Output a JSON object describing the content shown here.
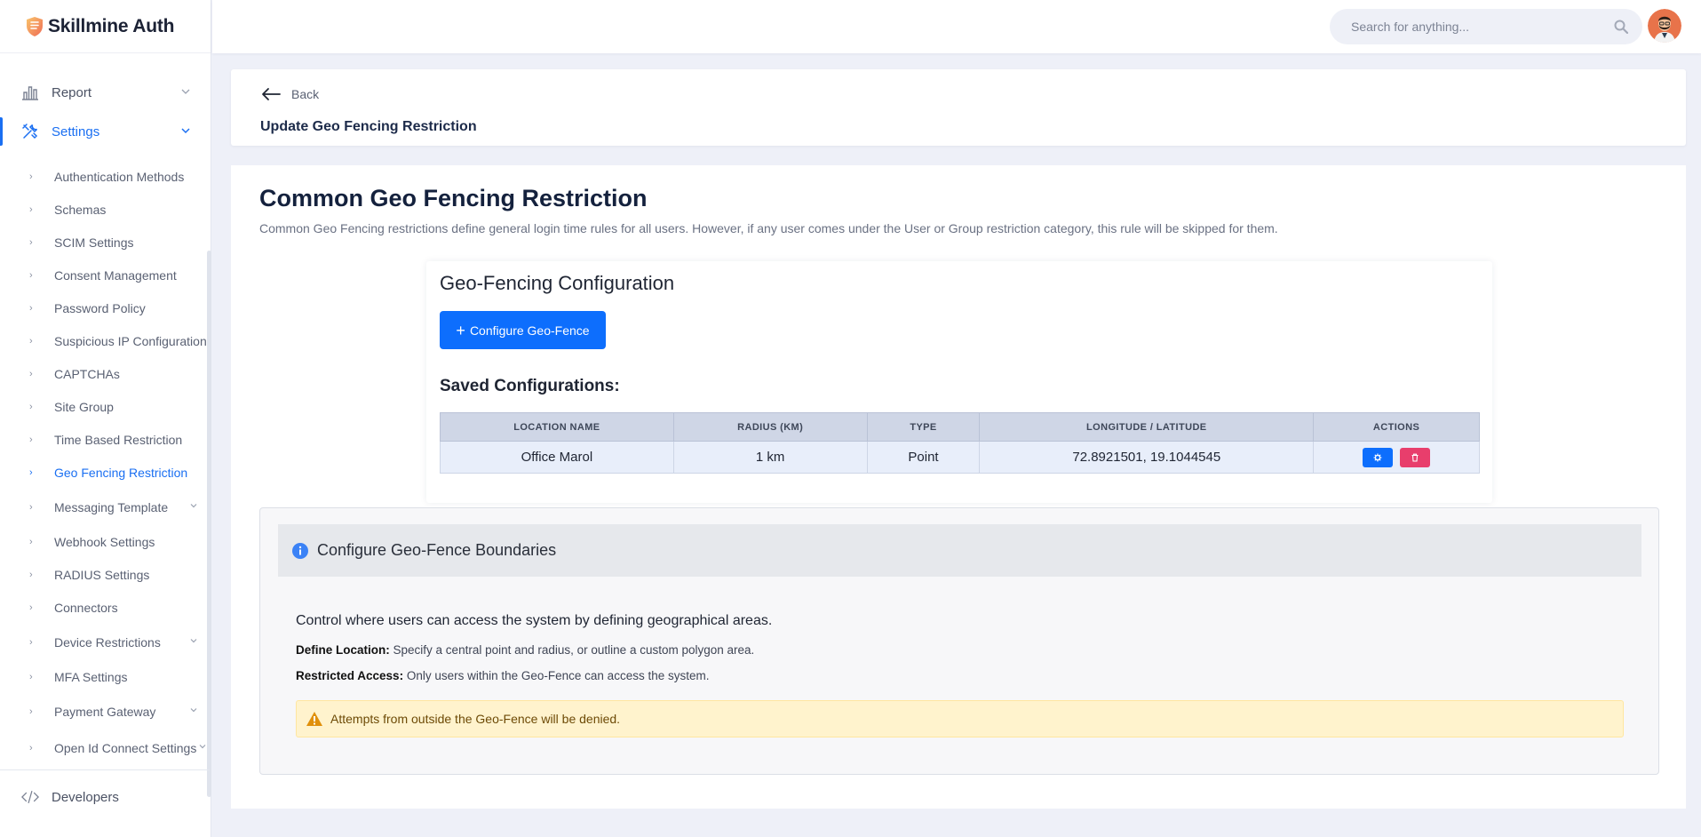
{
  "brand": {
    "name": "Skillmine Auth",
    "accent": "#1a6ff2"
  },
  "sidebar": {
    "top": [
      {
        "label": "Report",
        "icon": "bar-chart-icon"
      },
      {
        "label": "Settings",
        "icon": "tools-icon"
      }
    ],
    "sub": [
      {
        "label": "Authentication Methods"
      },
      {
        "label": "Schemas"
      },
      {
        "label": "SCIM Settings"
      },
      {
        "label": "Consent Management"
      },
      {
        "label": "Password Policy"
      },
      {
        "label": "Suspicious IP Configuration"
      },
      {
        "label": "CAPTCHAs"
      },
      {
        "label": "Site Group"
      },
      {
        "label": "Time Based Restriction"
      },
      {
        "label": "Geo Fencing Restriction"
      },
      {
        "label": "Messaging Template"
      },
      {
        "label": "Webhook Settings"
      },
      {
        "label": "RADIUS Settings"
      },
      {
        "label": "Connectors"
      },
      {
        "label": "Device Restrictions"
      },
      {
        "label": "MFA Settings"
      },
      {
        "label": "Payment Gateway"
      },
      {
        "label": "Open Id Connect Settings"
      }
    ],
    "bottom": {
      "label": "Developers",
      "icon": "code-icon"
    }
  },
  "header": {
    "search_placeholder": "Search for anything..."
  },
  "breadcrumb": {
    "back_label": "Back",
    "page_title": "Update Geo Fencing Restriction"
  },
  "main": {
    "title": "Common Geo Fencing Restriction",
    "description": "Common Geo Fencing restrictions define general login time rules for all users. However, if any user comes under the User or Group restriction category, this rule will be skipped for them.",
    "geo": {
      "title": "Geo-Fencing Configuration",
      "configure_button": "Configure Geo-Fence",
      "saved_title": "Saved Configurations:",
      "columns": [
        "LOCATION NAME",
        "RADIUS (KM)",
        "TYPE",
        "LONGITUDE / LATITUDE",
        "ACTIONS"
      ],
      "rows": [
        {
          "location": "Office Marol",
          "radius": "1 km",
          "type": "Point",
          "coords": "72.8921501, 19.1044545"
        }
      ]
    },
    "info": {
      "heading": "Configure Geo-Fence Boundaries",
      "lead": "Control where users can access the system by defining geographical areas.",
      "define_label": "Define Location:",
      "define_text": "Specify a central point and radius, or outline a custom polygon area.",
      "restrict_label": "Restricted Access:",
      "restrict_text": "Only users within the Geo-Fence can access the system.",
      "warning": "Attempts from outside the Geo-Fence will be denied."
    }
  }
}
